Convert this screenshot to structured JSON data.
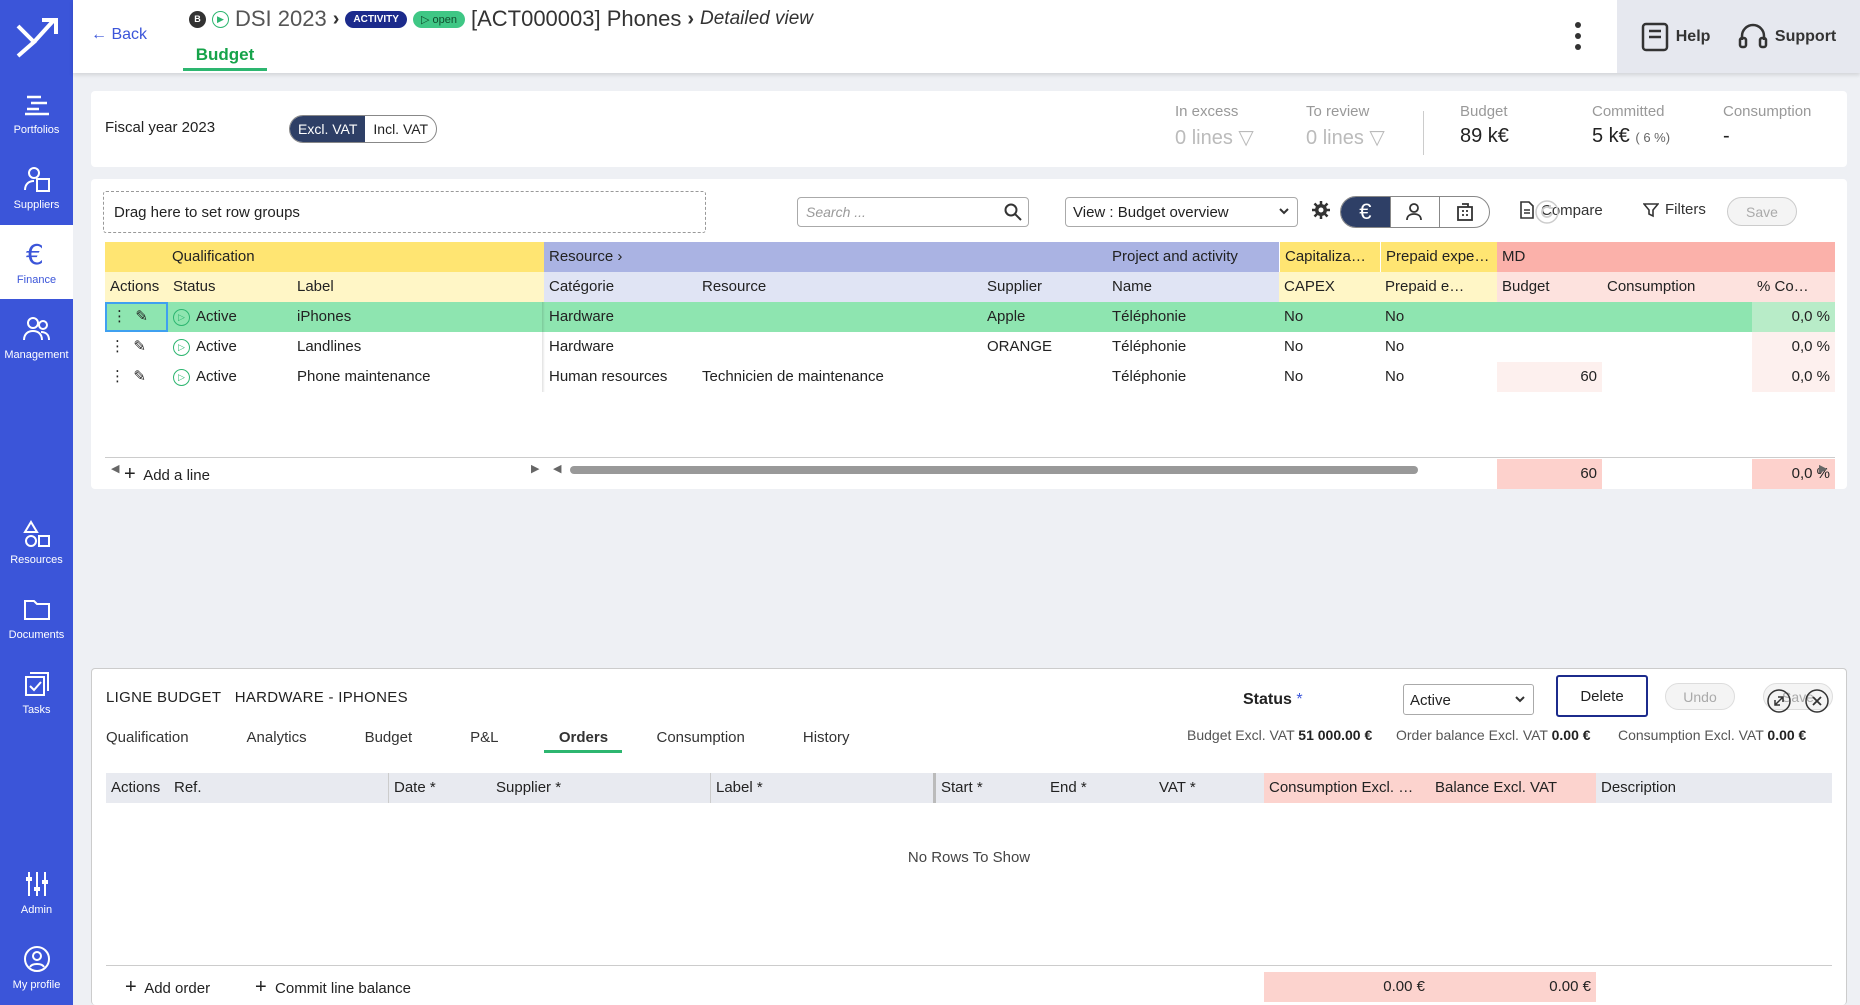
{
  "nav": {
    "items": [
      {
        "label": "Portfolios",
        "icon": "portfolios-icon"
      },
      {
        "label": "Suppliers",
        "icon": "suppliers-icon"
      },
      {
        "label": "Finance",
        "icon": "euro-icon"
      },
      {
        "label": "Management",
        "icon": "management-icon"
      },
      {
        "label": "Resources",
        "icon": "resources-icon"
      },
      {
        "label": "Documents",
        "icon": "folder-icon"
      },
      {
        "label": "Tasks",
        "icon": "tasks-icon"
      },
      {
        "label": "Admin",
        "icon": "sliders-icon"
      },
      {
        "label": "My profile",
        "icon": "profile-icon"
      }
    ]
  },
  "header": {
    "back": "Back",
    "badge_b": "B",
    "portfolio": "DSI 2023",
    "activity_tag": "ACTIVITY",
    "open_tag": "open",
    "title": "[ACT000003] Phones",
    "view": "Detailed view",
    "tab": "Budget",
    "help": "Help",
    "support": "Support"
  },
  "summary": {
    "fiscal_year": "Fiscal year 2023",
    "excl": "Excl. VAT",
    "incl": "Incl. VAT",
    "in_excess_label": "In excess",
    "in_excess_value": "0",
    "to_review_label": "To review",
    "to_review_value": "0",
    "lines_word": "lines",
    "budget_label": "Budget",
    "budget_value": "89 k€",
    "committed_label": "Committed",
    "committed_value": "5 k€",
    "committed_pct": "( 6 %)",
    "consumption_label": "Consumption",
    "consumption_value": "-"
  },
  "toolbar": {
    "drag_hint": "Drag here to set row groups",
    "search_placeholder": "Search ...",
    "view": "View : Budget overview",
    "euro": "€",
    "compare": "Compare",
    "filters": "Filters",
    "save": "Save"
  },
  "grid": {
    "groups": {
      "qualification": "Qualification",
      "resource": "Resource",
      "project": "Project and activity",
      "capitalization": "Capitaliza…",
      "prepaid": "Prepaid expe…",
      "md": "MD"
    },
    "columns": {
      "actions": "Actions",
      "status": "Status",
      "label": "Label",
      "categorie": "Catégorie",
      "resource": "Resource",
      "supplier": "Supplier",
      "name": "Name",
      "capex": "CAPEX",
      "prepaid": "Prepaid e…",
      "budget": "Budget",
      "consumption": "Consumption",
      "pct": "% Co…"
    },
    "rows": [
      {
        "status": "Active",
        "label": "iPhones",
        "categorie": "Hardware",
        "resource": "",
        "supplier": "Apple",
        "name": "Téléphonie",
        "capex": "No",
        "prepaid": "No",
        "budget": "",
        "consumption": "",
        "pct": "0,0 %"
      },
      {
        "status": "Active",
        "label": "Landlines",
        "categorie": "Hardware",
        "resource": "",
        "supplier": "ORANGE",
        "name": "Téléphonie",
        "capex": "No",
        "prepaid": "No",
        "budget": "",
        "consumption": "",
        "pct": "0,0 %"
      },
      {
        "status": "Active",
        "label": "Phone maintenance",
        "categorie": "Human resources",
        "resource": "Technicien de maintenance",
        "supplier": "",
        "name": "Téléphonie",
        "capex": "No",
        "prepaid": "No",
        "budget": "60",
        "consumption": "",
        "pct": "0,0 %"
      }
    ],
    "add_line": "Add a line",
    "total_budget": "60",
    "total_pct": "0,0 %"
  },
  "detail": {
    "title1": "LIGNE BUDGET",
    "title2": "HARDWARE - IPHONES",
    "status_label": "Status",
    "status_required": "*",
    "status_value": "Active",
    "delete": "Delete",
    "undo": "Undo",
    "save": "Save",
    "tabs": [
      "Qualification",
      "Analytics",
      "Budget",
      "P&L",
      "Orders",
      "Consumption",
      "History"
    ],
    "budget_excl_label": "Budget Excl. VAT",
    "budget_excl_value": "51 000.00 €",
    "order_balance_label": "Order balance Excl. VAT",
    "order_balance_value": "0.00 €",
    "consumption_excl_label": "Consumption Excl. VAT",
    "consumption_excl_value": "0.00 €",
    "columns": {
      "actions": "Actions",
      "ref": "Ref.",
      "date": "Date *",
      "supplier": "Supplier *",
      "label": "Label *",
      "start": "Start *",
      "end": "End *",
      "vat": "VAT *",
      "consumption": "Consumption Excl. …",
      "balance": "Balance Excl. VAT",
      "description": "Description"
    },
    "empty": "No Rows To Show",
    "add_order": "Add order",
    "commit": "Commit line balance",
    "total_consumption": "0.00 €",
    "total_balance": "0.00 €"
  }
}
